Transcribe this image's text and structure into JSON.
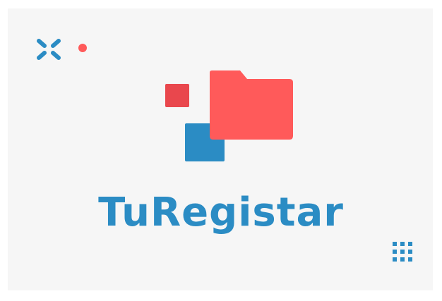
{
  "brand": {
    "name": "TuRegistar"
  },
  "colors": {
    "background": "#f6f6f6",
    "blue": "#2b8cc4",
    "red": "#ff5a5a",
    "red_dark": "#e9474d"
  },
  "decorations": {
    "corner_top_left": "x-cross-icon",
    "corner_dot": "dot-icon",
    "corner_bottom_right": "dot-grid-icon",
    "logo_main": "folder-icon"
  }
}
